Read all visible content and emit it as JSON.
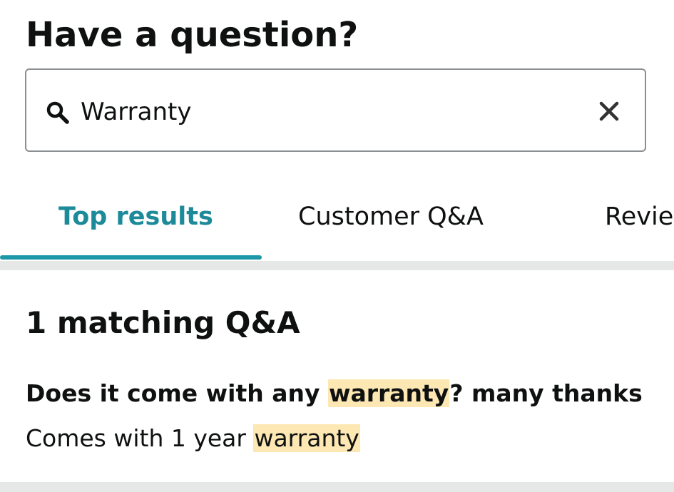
{
  "header": {
    "title": "Have a question?"
  },
  "search": {
    "value": "Warranty",
    "placeholder": "",
    "search_icon": "search-icon",
    "clear_icon": "close-icon"
  },
  "tabs": [
    {
      "label": "Top results",
      "active": true
    },
    {
      "label": "Customer Q&A",
      "active": false
    },
    {
      "label": "Revie",
      "active": false
    }
  ],
  "results": {
    "count_label": "1 matching Q&A",
    "items": [
      {
        "question_before": "Does it come with any ",
        "question_highlight": "warranty",
        "question_after": "? many thanks",
        "answer_before": "Comes with 1 year ",
        "answer_highlight": "warranty"
      }
    ]
  },
  "colors": {
    "accent": "#1d8a99",
    "highlight": "#fde8b4",
    "text": "#0f1111",
    "border": "#8b8f92",
    "divider": "#e6e8e8"
  }
}
